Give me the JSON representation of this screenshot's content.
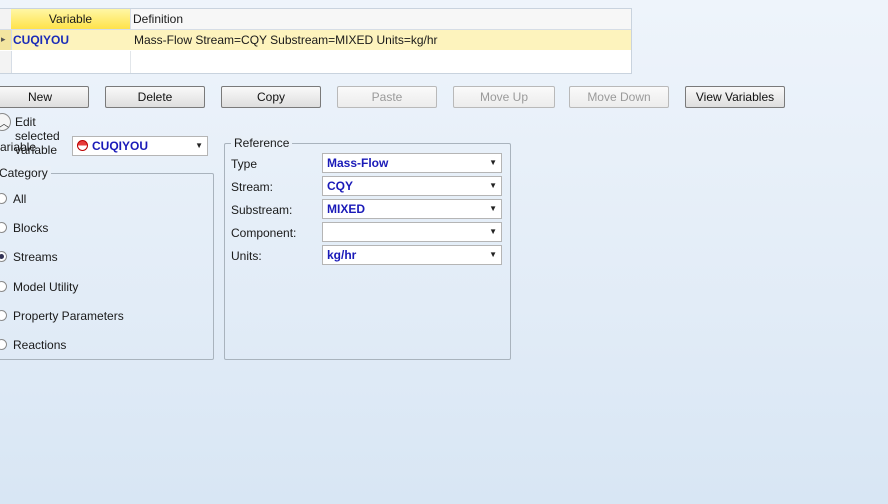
{
  "grid": {
    "col_variable": "Variable",
    "col_definition": "Definition",
    "rows": [
      {
        "variable": "CUQIYOU",
        "definition": "Mass-Flow Stream=CQY Substream=MIXED Units=kg/hr"
      }
    ]
  },
  "buttons": {
    "new": "New",
    "delete": "Delete",
    "copy": "Copy",
    "paste": "Paste",
    "move_up": "Move Up",
    "move_down": "Move Down",
    "view_variables": "View Variables"
  },
  "edit_selected": "Edit selected variable",
  "variable": {
    "label": "ariable",
    "value": "CUQIYOU"
  },
  "category": {
    "title": "Category",
    "options": [
      "All",
      "Blocks",
      "Streams",
      "Model Utility",
      "Property Parameters",
      "Reactions"
    ],
    "selected": "Streams"
  },
  "reference": {
    "title": "Reference",
    "type_label": "Type",
    "type_value": "Mass-Flow",
    "stream_label": "Stream:",
    "stream_value": "CQY",
    "substream_label": "Substream:",
    "substream_value": "MIXED",
    "component_label": "Component:",
    "component_value": "",
    "units_label": "Units:",
    "units_value": "kg/hr"
  },
  "icons": {
    "dropdown": "chevron-down-icon",
    "collapse": "chevron-up-icon",
    "variable": "stop-icon"
  }
}
